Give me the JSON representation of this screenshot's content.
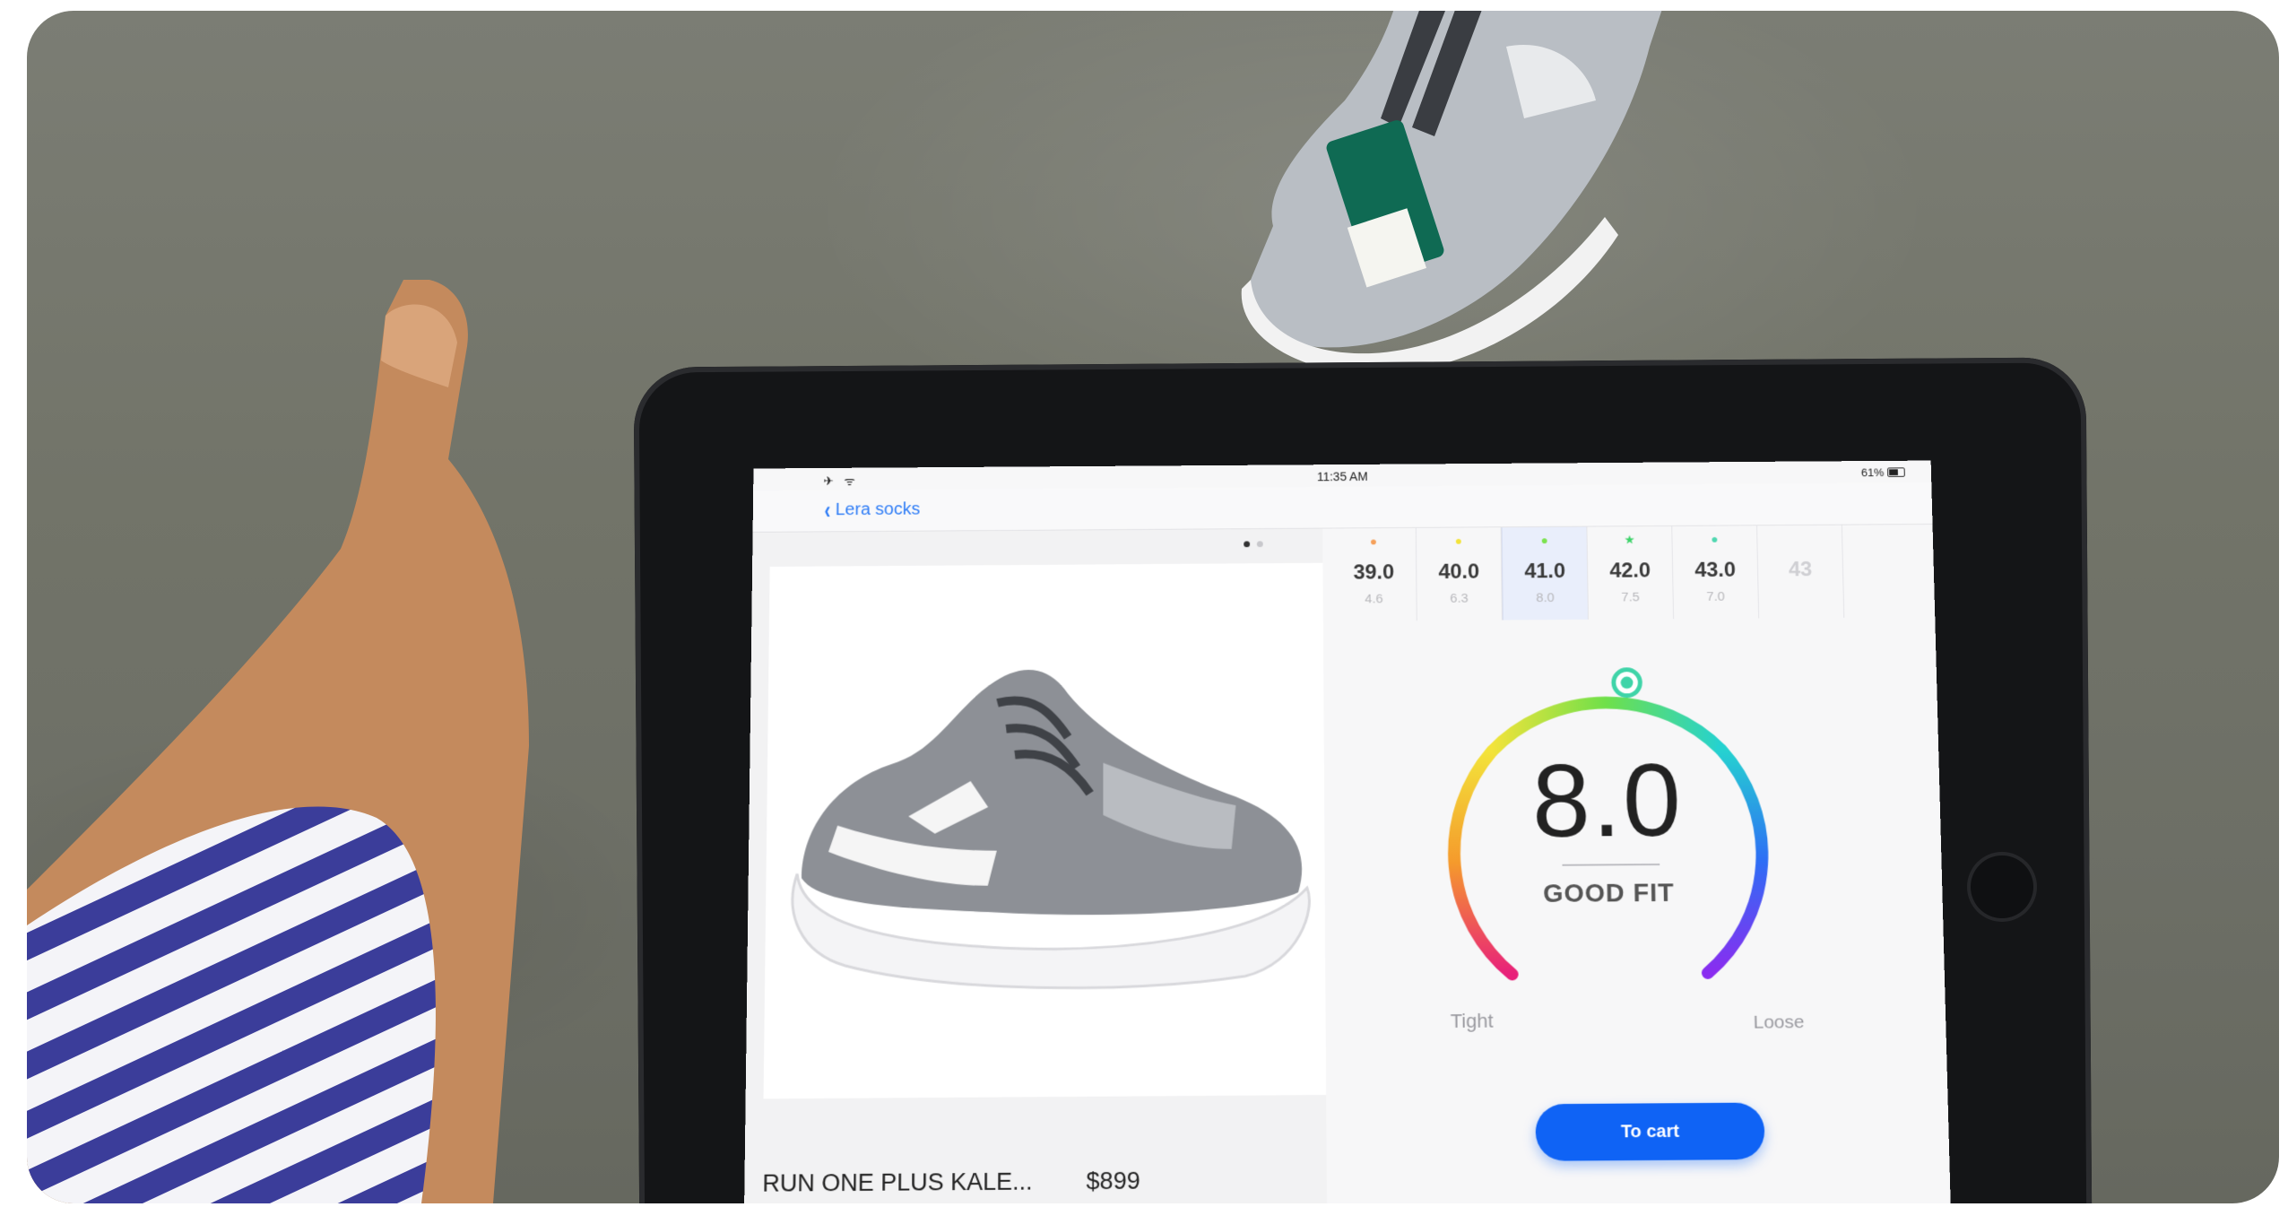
{
  "status_bar": {
    "time": "11:35 AM",
    "battery": "61%"
  },
  "nav": {
    "back_label": "Lera socks"
  },
  "product": {
    "name": "RUN ONE PLUS KALE...",
    "price": "$899",
    "gallery_pages": 2,
    "gallery_active": 1
  },
  "sizes": [
    {
      "eu": "39.0",
      "us": "4.6",
      "marker": "●",
      "marker_color": "#f5a05a"
    },
    {
      "eu": "40.0",
      "us": "6.3",
      "marker": "●",
      "marker_color": "#f3e33a"
    },
    {
      "eu": "41.0",
      "us": "8.0",
      "marker": "●",
      "marker_color": "#7be24e",
      "selected": true
    },
    {
      "eu": "42.0",
      "us": "7.5",
      "marker": "★",
      "marker_color": "#3ed36a"
    },
    {
      "eu": "43.0",
      "us": "7.0",
      "marker": "●",
      "marker_color": "#4fd7b0"
    },
    {
      "eu": "43",
      "us": "",
      "marker": "",
      "marker_color": "#cfcfd3",
      "faded": true
    }
  ],
  "fit": {
    "score": "8.0",
    "label": "GOOD FIT",
    "tight_label": "Tight",
    "loose_label": "Loose",
    "level": 0.62
  },
  "cart": {
    "label": "To cart"
  },
  "colors": {
    "accent": "#0f63f5",
    "link": "#2f7df6"
  }
}
